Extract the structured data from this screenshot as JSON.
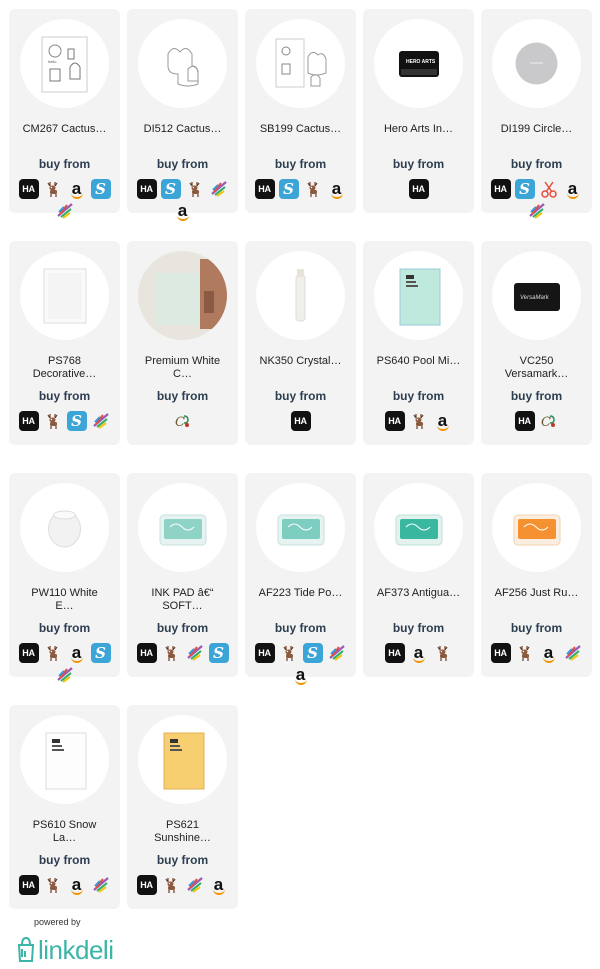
{
  "products": [
    {
      "name": "CM267 Cactus…",
      "buy": "buy from",
      "image": "stamp-sheet",
      "shops": [
        "HA",
        "deer",
        "amazon",
        "scrapbook"
      ],
      "shops_row2": [
        "bird"
      ]
    },
    {
      "name": "DI512 Cactus…",
      "buy": "buy from",
      "image": "die-outline",
      "shops": [
        "HA",
        "scrapbook",
        "deer",
        "bird"
      ],
      "shops_row2": [
        "amazon"
      ]
    },
    {
      "name": "SB199 Cactus…",
      "buy": "buy from",
      "image": "stamp-die-set",
      "shops": [
        "HA",
        "scrapbook",
        "deer",
        "amazon"
      ],
      "shops_row2": []
    },
    {
      "name": "Hero Arts In…",
      "buy": "buy from",
      "image": "ink-pad-black",
      "shops": [
        "HA"
      ],
      "shops_row2": []
    },
    {
      "name": "DI199 Circle…",
      "buy": "buy from",
      "image": "circle-die",
      "shops": [
        "HA",
        "scrapbook",
        "scissors",
        "amazon"
      ],
      "shops_row2": [
        "bird"
      ]
    },
    {
      "name": "PS768\nDecorative…",
      "buy": "buy from",
      "image": "paper-white",
      "shops": [
        "HA",
        "deer",
        "scrapbook",
        "bird"
      ],
      "shops_row2": []
    },
    {
      "name": "Premium White\nC…",
      "buy": "buy from",
      "image": "paper-photo",
      "shops": [
        "cp"
      ],
      "shops_row2": []
    },
    {
      "name": "NK350 Crystal…",
      "buy": "buy from",
      "image": "glue-tube",
      "shops": [
        "HA"
      ],
      "shops_row2": []
    },
    {
      "name": "PS640 Pool Mi…",
      "buy": "buy from",
      "image": "paper-mint",
      "shops": [
        "HA",
        "deer",
        "amazon"
      ],
      "shops_row2": []
    },
    {
      "name": "VC250\nVersamark…",
      "buy": "buy from",
      "image": "versamark-pad",
      "shops": [
        "HA",
        "cp"
      ],
      "shops_row2": []
    },
    {
      "name": "PW110 White\nE…",
      "buy": "buy from",
      "image": "white-powder",
      "shops": [
        "HA",
        "deer",
        "amazon",
        "scrapbook"
      ],
      "shops_row2": [
        "bird"
      ]
    },
    {
      "name": "INK PAD â€“\nSOFT…",
      "buy": "buy from",
      "image": "pad-soft",
      "shops": [
        "HA",
        "deer",
        "bird",
        "scrapbook"
      ],
      "shops_row2": []
    },
    {
      "name": "AF223 Tide Po…",
      "buy": "buy from",
      "image": "pad-tide",
      "shops": [
        "HA",
        "deer",
        "scrapbook",
        "bird"
      ],
      "shops_row2": [
        "amazon"
      ]
    },
    {
      "name": "AF373 Antigua…",
      "buy": "buy from",
      "image": "pad-antigua",
      "shops": [
        "HA",
        "amazon",
        "deer"
      ],
      "shops_row2": []
    },
    {
      "name": "AF256 Just Ru…",
      "buy": "buy from",
      "image": "pad-orange",
      "shops": [
        "HA",
        "deer",
        "amazon",
        "bird"
      ],
      "shops_row2": []
    },
    {
      "name": "PS610 Snow\nLa…",
      "buy": "buy from",
      "image": "paper-snow",
      "shops": [
        "HA",
        "deer",
        "amazon",
        "bird"
      ],
      "shops_row2": []
    },
    {
      "name": "PS621\nSunshine…",
      "buy": "buy from",
      "image": "paper-yellow",
      "shops": [
        "HA",
        "deer",
        "bird",
        "amazon"
      ],
      "shops_row2": []
    }
  ],
  "shop_labels": {
    "HA": "HA",
    "scrapbook": "S",
    "amazon": "a"
  },
  "footer": {
    "powered": "powered by",
    "logo": "linkdeli"
  },
  "colors": {
    "card_bg": "#f3f3f3",
    "buy_text": "#2c3e50",
    "logo": "#3bb5a8",
    "scrapbook": "#3aa5d6",
    "amazon_smile": "#f39200"
  }
}
